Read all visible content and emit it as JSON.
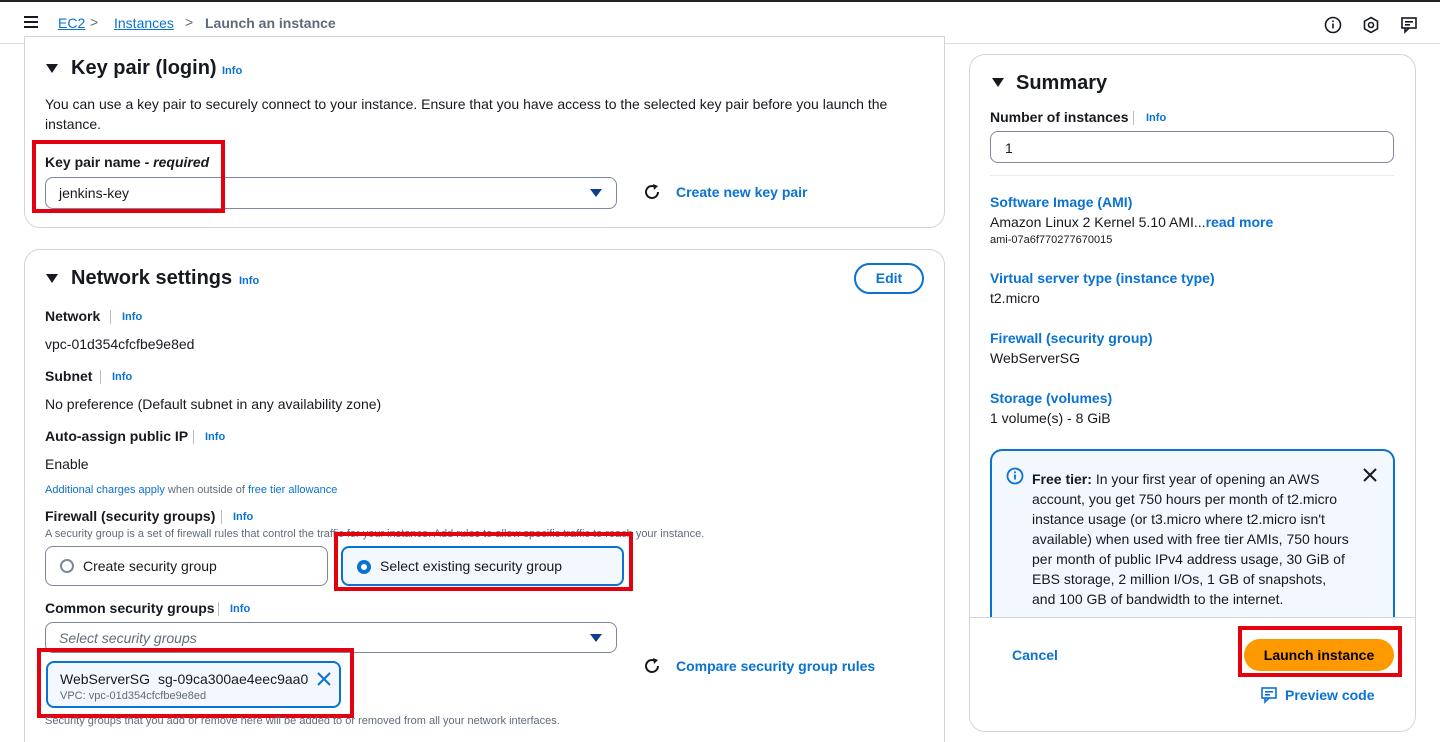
{
  "breadcrumb": {
    "root": "EC2",
    "parent": "Instances",
    "current": "Launch an instance"
  },
  "key_pair": {
    "title": "Key pair (login)",
    "info": "Info",
    "description": "You can use a key pair to securely connect to your instance. Ensure that you have access to the selected key pair before you launch the instance.",
    "field_label": "Key pair name",
    "field_required": "- required",
    "selected": "jenkins-key",
    "create_link": "Create new key pair"
  },
  "network": {
    "title": "Network settings",
    "info": "Info",
    "edit": "Edit",
    "network_label": "Network",
    "network_value": "vpc-01d354cfcfbe9e8ed",
    "subnet_label": "Subnet",
    "subnet_value": "No preference (Default subnet in any availability zone)",
    "public_ip_label": "Auto-assign public IP",
    "public_ip_value": "Enable",
    "charges_link": "Additional charges apply",
    "charges_mid": "when outside of",
    "free_tier_link": "free tier allowance",
    "firewall_label": "Firewall (security groups)",
    "firewall_desc": "A security group is a set of firewall rules that control the traffic for your instance. Add rules to allow specific traffic to reach your instance.",
    "option_create": "Create security group",
    "option_select": "Select existing security group",
    "common_label": "Common security groups",
    "select_placeholder": "Select security groups",
    "compare_link": "Compare security group rules",
    "token_name": "WebServerSG",
    "token_id": "sg-09ca300ae4eec9aa0",
    "token_vpc": "VPC: vpc-01d354cfcfbe9e8ed",
    "footnote": "Security groups that you add or remove here will be added to or removed from all your network interfaces."
  },
  "summary": {
    "title": "Summary",
    "instances_label": "Number of instances",
    "info": "Info",
    "instances_value": "1",
    "ami_label": "Software Image (AMI)",
    "ami_value": "Amazon Linux 2 Kernel 5.10 AMI...",
    "ami_more": "read more",
    "ami_id": "ami-07a6f770277670015",
    "type_label": "Virtual server type (instance type)",
    "type_value": "t2.micro",
    "firewall_label": "Firewall (security group)",
    "firewall_value": "WebServerSG",
    "storage_label": "Storage (volumes)",
    "storage_value": "1 volume(s) - 8 GiB",
    "free_tier_bold": "Free tier:",
    "free_tier_text": "In your first year of opening an AWS account, you get 750 hours per month of t2.micro instance usage (or t3.micro where t2.micro isn't available) when used with free tier AMIs, 750 hours per month of public IPv4 address usage, 30 GiB of EBS storage, 2 million I/Os, 1 GB of snapshots, and 100 GB of bandwidth to the internet.",
    "cancel": "Cancel",
    "launch": "Launch instance",
    "preview": "Preview code"
  },
  "colors": {
    "link": "#0972d3",
    "highlight": "#e4000f",
    "launch": "#ff9900"
  }
}
